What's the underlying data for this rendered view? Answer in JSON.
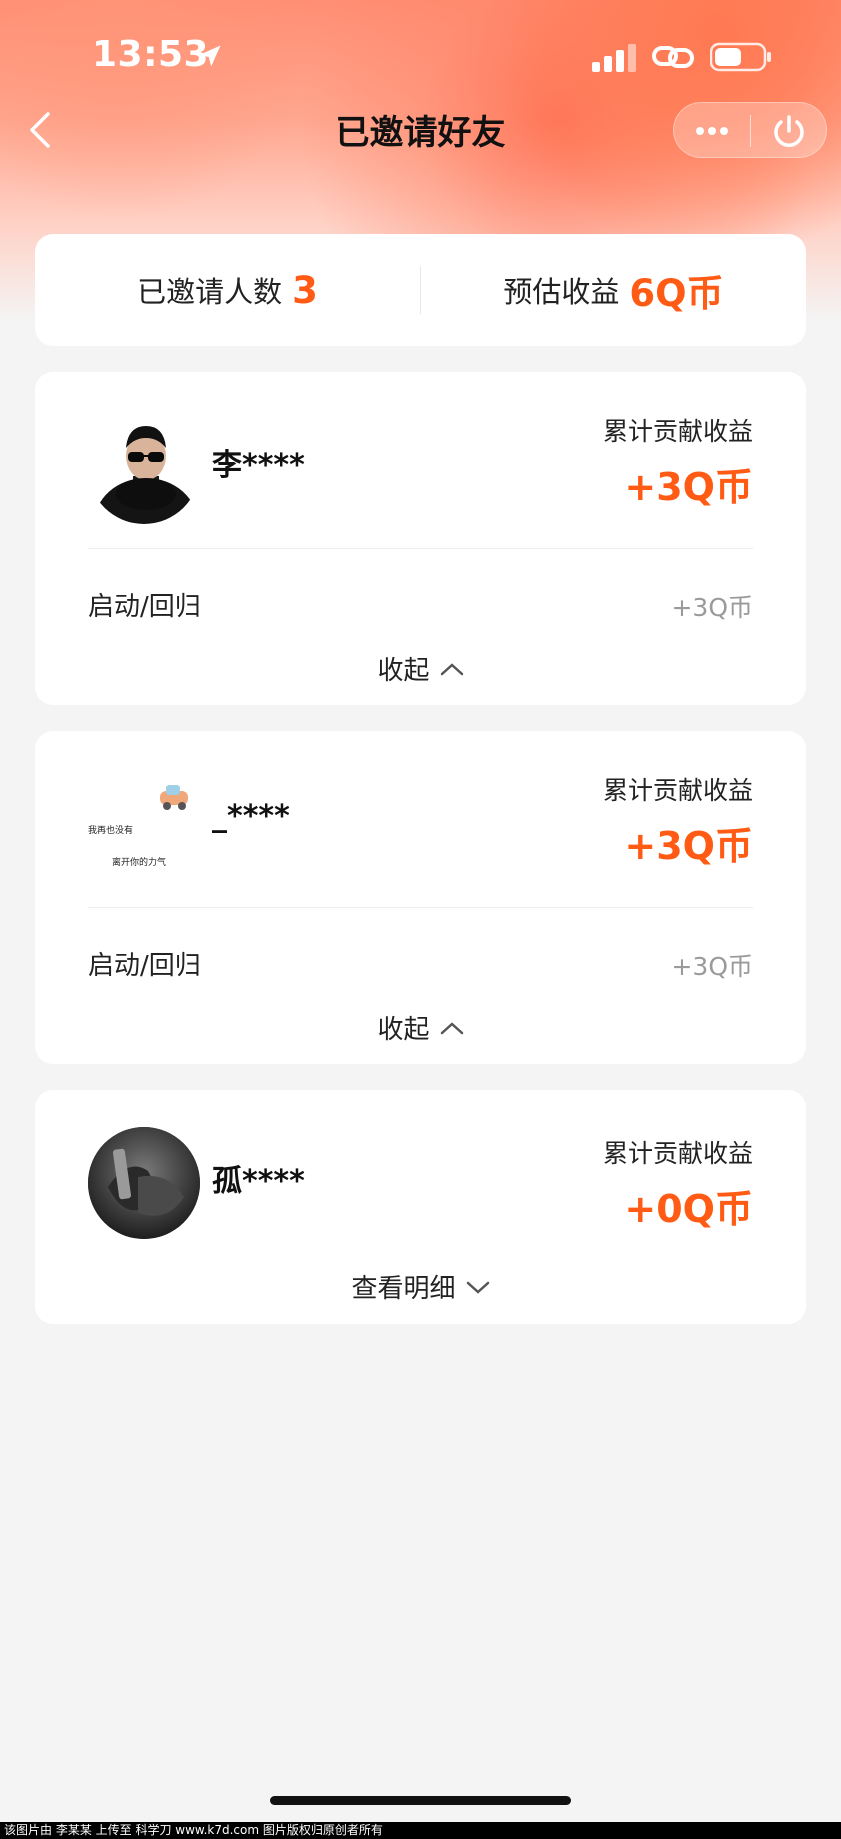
{
  "status_bar": {
    "time": "13:53"
  },
  "nav": {
    "title": "已邀请好友"
  },
  "summary": {
    "invited_label": "已邀请人数",
    "invited_count": "3",
    "earnings_label": "预估收益",
    "earnings_value": "6Q币"
  },
  "friends": [
    {
      "name": "李****",
      "contrib_label": "累计贡献收益",
      "contrib_value": "+3Q币",
      "detail_label": "启动/回归",
      "detail_value": "+3Q币",
      "toggle_label": "收起"
    },
    {
      "name": "_****",
      "avatar_text_1": "我再也没有",
      "avatar_text_2": "离开你的力气",
      "contrib_label": "累计贡献收益",
      "contrib_value": "+3Q币",
      "detail_label": "启动/回归",
      "detail_value": "+3Q币",
      "toggle_label": "收起"
    },
    {
      "name": "孤****",
      "contrib_label": "累计贡献收益",
      "contrib_value": "+0Q币",
      "toggle_label": "查看明细"
    }
  ],
  "watermark": "该图片由 李某某 上传至 科学刀 www.k7d.com 图片版权归原创者所有",
  "colors": {
    "accent": "#ff5b14",
    "background": "#f4f4f4",
    "card": "#ffffff"
  },
  "icons": [
    "location-arrow-icon",
    "signal-icon",
    "link-icon",
    "battery-icon",
    "back-icon",
    "more-icon",
    "power-icon",
    "chevron-up-icon",
    "chevron-down-icon"
  ]
}
